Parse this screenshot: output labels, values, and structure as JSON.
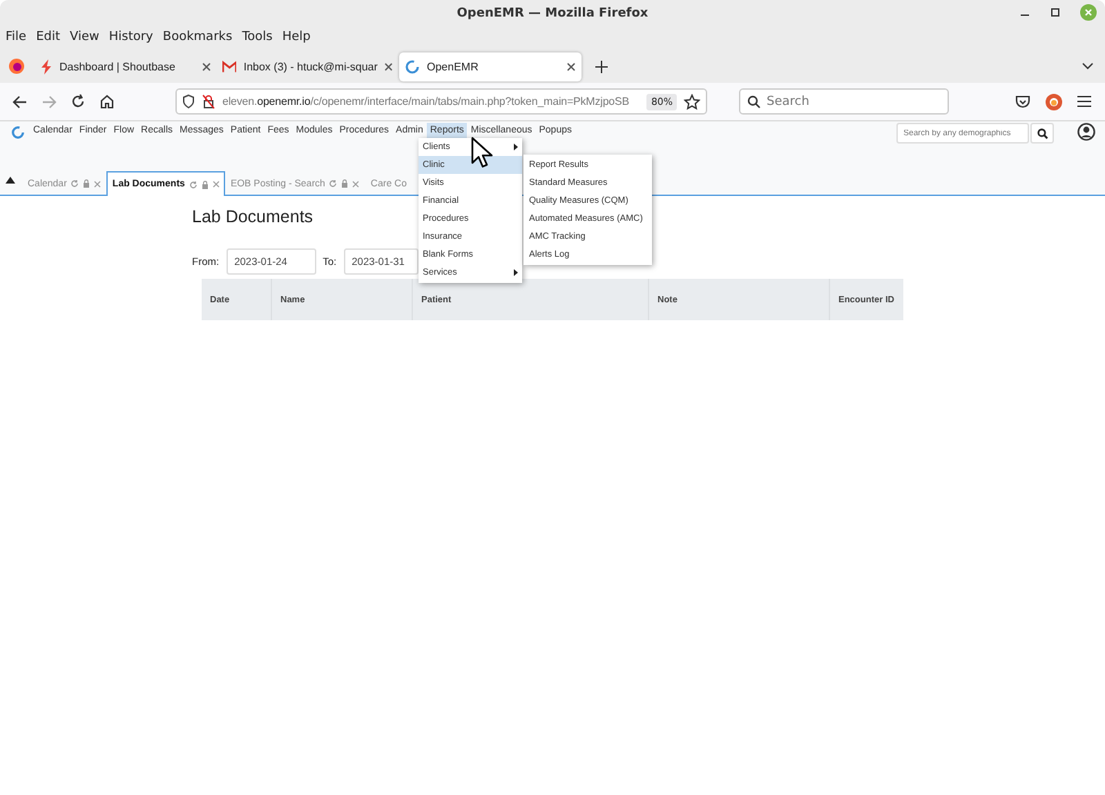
{
  "window": {
    "title": "OpenEMR — Mozilla Firefox"
  },
  "menu_bar": [
    "File",
    "Edit",
    "View",
    "History",
    "Bookmarks",
    "Tools",
    "Help"
  ],
  "browser_tabs": [
    {
      "label": "Dashboard | Shoutbase",
      "selected": false,
      "kind": "bolt"
    },
    {
      "label": "Inbox (3) - htuck@mi-squar",
      "selected": false,
      "kind": "mail"
    },
    {
      "label": "OpenEMR",
      "selected": true,
      "kind": "emr"
    }
  ],
  "address_bar": {
    "prefix": "eleven.",
    "domain": "openemr.io",
    "path": "/c/openemr/interface/main/tabs/main.php?token_main=PkMzjpoSB",
    "zoom": "80%"
  },
  "browser_search": {
    "placeholder": "Search"
  },
  "app_nav": [
    {
      "label": "Calendar",
      "selected": false
    },
    {
      "label": "Finder",
      "selected": false
    },
    {
      "label": "Flow",
      "selected": false
    },
    {
      "label": "Recalls",
      "selected": false
    },
    {
      "label": "Messages",
      "selected": false
    },
    {
      "label": "Patient",
      "selected": false
    },
    {
      "label": "Fees",
      "selected": false
    },
    {
      "label": "Modules",
      "selected": false
    },
    {
      "label": "Procedures",
      "selected": false
    },
    {
      "label": "Admin",
      "selected": false
    },
    {
      "label": "Reports",
      "selected": true
    },
    {
      "label": "Miscellaneous",
      "selected": false
    },
    {
      "label": "Popups",
      "selected": false
    }
  ],
  "patient_search": {
    "placeholder": "Search by any demographics"
  },
  "app_tabs": [
    {
      "label": "Calendar",
      "selected": false,
      "controls": true
    },
    {
      "label": "Lab Documents",
      "selected": true,
      "controls": true
    },
    {
      "label": "EOB Posting - Search",
      "selected": false,
      "controls": true
    },
    {
      "label": "Care Co",
      "selected": false,
      "controls": false
    }
  ],
  "reports_menu": [
    {
      "label": "Clients",
      "selected": false,
      "submenu": true
    },
    {
      "label": "Clinic",
      "selected": true,
      "submenu": false
    },
    {
      "label": "Visits",
      "selected": false,
      "submenu": false
    },
    {
      "label": "Financial",
      "selected": false,
      "submenu": false
    },
    {
      "label": "Procedures",
      "selected": false,
      "submenu": false
    },
    {
      "label": "Insurance",
      "selected": false,
      "submenu": false
    },
    {
      "label": "Blank Forms",
      "selected": false,
      "submenu": false
    },
    {
      "label": "Services",
      "selected": false,
      "submenu": true
    }
  ],
  "clinic_submenu": [
    "Report Results",
    "Standard Measures",
    "Quality Measures (CQM)",
    "Automated Measures (AMC)",
    "AMC Tracking",
    "Alerts Log"
  ],
  "page": {
    "heading": "Lab Documents",
    "from_label": "From:",
    "from_value": "2023-01-24",
    "to_label": "To:",
    "to_value": "2023-01-31"
  },
  "table": {
    "columns": [
      "Date",
      "Name",
      "Patient",
      "Note",
      "Encounter ID"
    ]
  }
}
